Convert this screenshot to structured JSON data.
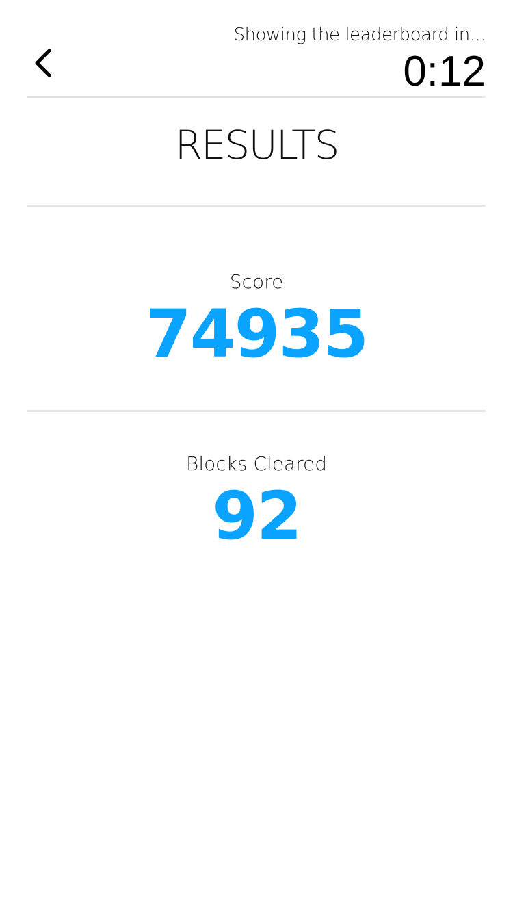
{
  "header": {
    "back_icon": "chevron-left-icon",
    "countdown_caption": "Showing the leaderboard in...",
    "countdown_timer": "0:12"
  },
  "main": {
    "title": "RESULTS",
    "stats": [
      {
        "label": "Score",
        "value": "74935"
      },
      {
        "label": "Blocks Cleared",
        "value": "92"
      }
    ]
  },
  "colors": {
    "accent": "#0aa3ff",
    "divider": "#e6e6e6",
    "background": "#ffffff"
  }
}
